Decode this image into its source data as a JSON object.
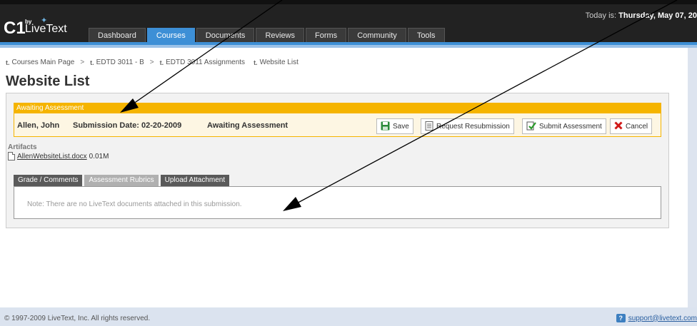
{
  "header": {
    "logo_c1": "C1",
    "logo_by": "by",
    "logo_name": "LiveText",
    "today_prefix": "Today is: ",
    "today_date": "Thursday, May 07, 20"
  },
  "nav": {
    "tabs": [
      {
        "label": "Dashboard",
        "active": false
      },
      {
        "label": "Courses",
        "active": true
      },
      {
        "label": "Documents",
        "active": false
      },
      {
        "label": "Reviews",
        "active": false
      },
      {
        "label": "Forms",
        "active": false
      },
      {
        "label": "Community",
        "active": false
      },
      {
        "label": "Tools",
        "active": false
      }
    ]
  },
  "breadcrumb": {
    "items": [
      "Courses Main Page",
      "EDTD 3011 - B",
      "EDTD 3011 Assignments",
      "Website List"
    ],
    "separator": ">",
    "icon_glyph": "t."
  },
  "page": {
    "title": "Website List"
  },
  "assessment": {
    "status_header": "Awaiting Assessment",
    "student_name": "Allen, John",
    "submission_date": "Submission Date: 02-20-2009",
    "status": "Awaiting Assessment",
    "buttons": {
      "save": "Save",
      "request_resubmission": "Request Resubmission",
      "submit_assessment": "Submit Assessment",
      "cancel": "Cancel"
    }
  },
  "artifacts": {
    "label": "Artifacts",
    "file_name": "AllenWebsiteList.docx",
    "file_size": "0.01M"
  },
  "subtabs": {
    "items": [
      {
        "label": "Grade / Comments",
        "active": false
      },
      {
        "label": "Assessment Rubrics",
        "active": true
      },
      {
        "label": "Upload Attachment",
        "active": false
      }
    ],
    "note": "Note: There are no LiveText documents attached in this submission."
  },
  "footer": {
    "copyright": "© 1997-2009 LiveText, Inc. All rights reserved.",
    "support_email": "support@livetext.com"
  },
  "colors": {
    "accent_blue": "#3d8fd6",
    "status_orange": "#f5b400",
    "header_dark": "#222222",
    "footer_bg": "#dbe3ef"
  },
  "icons": {
    "save": "floppy-disk-icon",
    "request_resubmission": "document-icon",
    "submit_assessment": "checkmark-document-icon",
    "cancel": "red-x-icon",
    "support": "question-icon"
  }
}
